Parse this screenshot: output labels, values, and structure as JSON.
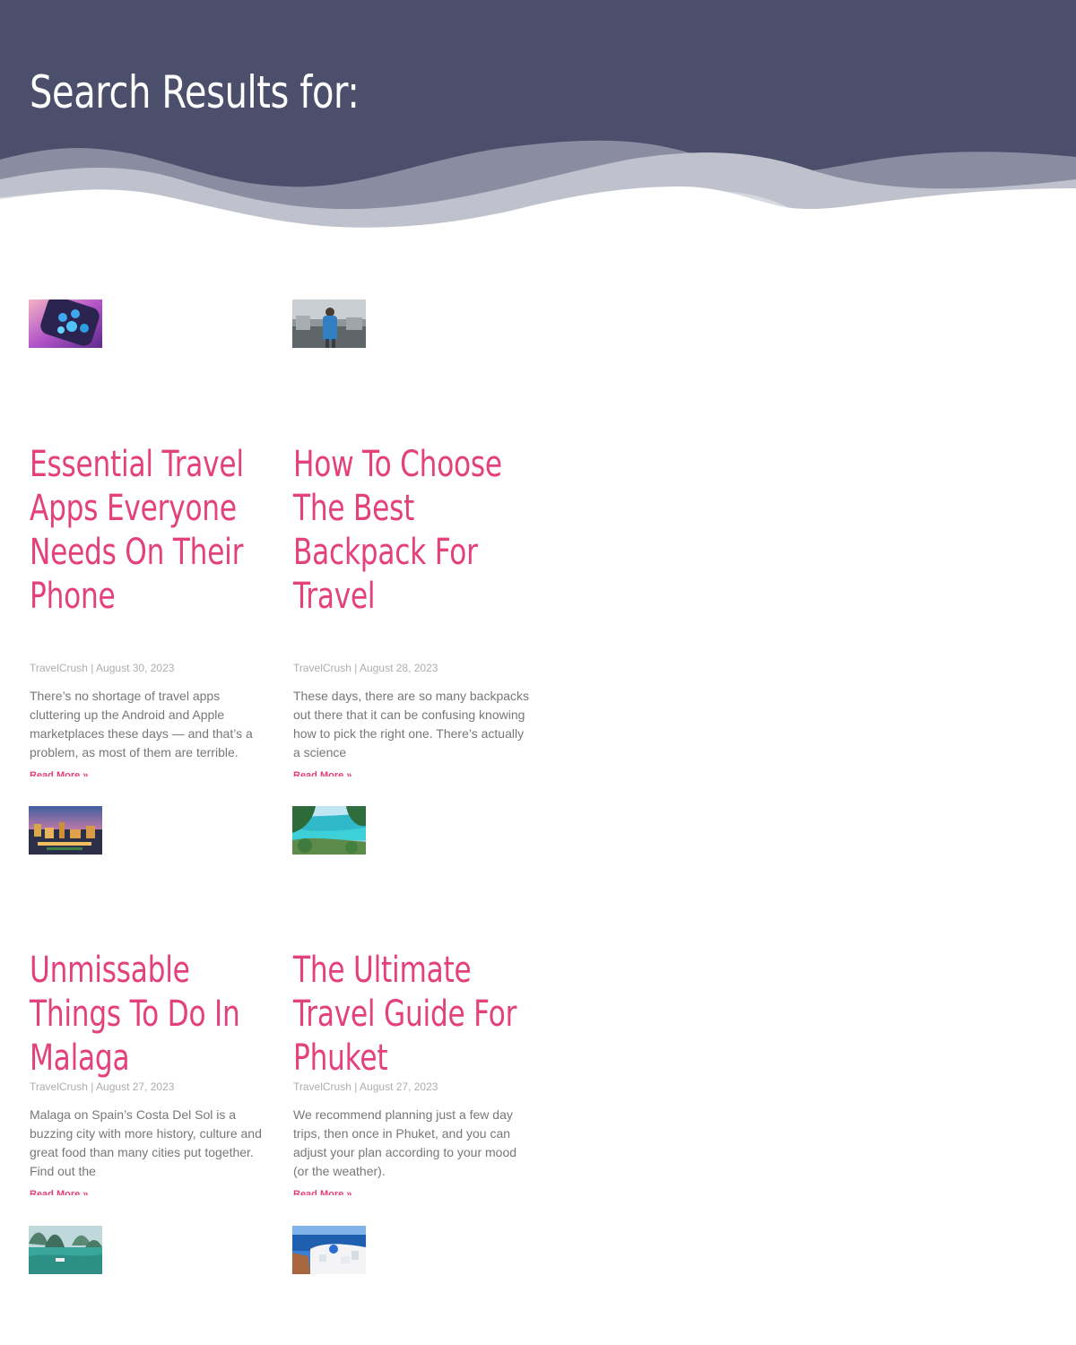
{
  "header": {
    "title": "Search Results for:"
  },
  "colors": {
    "header_bg": "#4b4f6b",
    "accent": "#e4407b",
    "meta": "#adadad",
    "text": "#777777"
  },
  "posts": [
    {
      "thumb_icon": "smartwatch-apps-image",
      "title": "Essential Travel Apps Everyone Needs On Their Phone",
      "author": "TravelCrush",
      "sep": "|",
      "date": "August 30, 2023",
      "excerpt": "There’s no shortage of travel apps cluttering up the Android and Apple marketplaces these days — and that’s a problem, as most of them are terrible.",
      "read_more": "Read More »"
    },
    {
      "thumb_icon": "backpacker-street-image",
      "title": "How To Choose The Best Backpack For Travel",
      "author": "TravelCrush",
      "sep": "|",
      "date": "August 28, 2023",
      "excerpt": "These days, there are so many backpacks out there that it can be confusing knowing how to pick the right one. There’s actually a science",
      "read_more": "Read More »"
    },
    {
      "thumb_icon": "malaga-city-night-image",
      "title": "Unmissable Things To Do In Malaga",
      "author": "TravelCrush",
      "sep": "|",
      "date": "August 27, 2023",
      "excerpt": "Malaga on Spain’s Costa Del Sol is a buzzing city with more history, culture and great food than many cities put together. Find out the",
      "read_more": "Read More »"
    },
    {
      "thumb_icon": "phuket-beach-image",
      "title": "The Ultimate Travel Guide For Phuket",
      "author": "TravelCrush",
      "sep": "|",
      "date": "August 27, 2023",
      "excerpt": "We recommend planning just a few day trips, then once in Phuket, and you can adjust your plan according to your mood (or the weather).",
      "read_more": "Read More »"
    },
    {
      "thumb_icon": "halong-bay-image"
    },
    {
      "thumb_icon": "santorini-image"
    }
  ]
}
